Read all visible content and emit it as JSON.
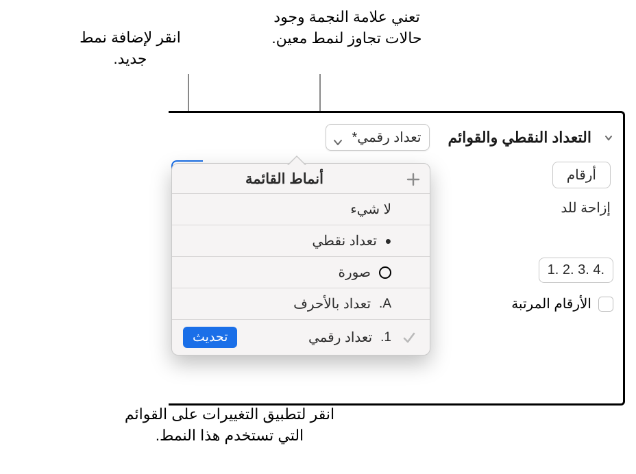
{
  "callouts": {
    "asterisk": "تعني علامة النجمة وجود حالات تجاوز لنمط معين.",
    "add_style": "انقر لإضافة نمط جديد.",
    "update": "انقر لتطبيق التغييرات على القوائم التي تستخدم هذا النمط."
  },
  "panel": {
    "section_title": "التعداد النقطي والقوائم",
    "style_button_label": "تعداد رقمي*",
    "numbers_button": "أرقام",
    "indent_label": "إزاحة للد",
    "number_example": "1. 2. 3. 4.",
    "ordered_numbers_label": "الأرقام المرتبة"
  },
  "popover": {
    "title": "أنماط القائمة",
    "items": [
      {
        "label": "لا شيء"
      },
      {
        "label": "تعداد نقطي"
      },
      {
        "label": "صورة"
      },
      {
        "label": "تعداد بالأحرف",
        "prefix": "A."
      },
      {
        "label": "تعداد رقمي",
        "prefix": "1.",
        "selected": true,
        "update": true
      }
    ],
    "update_label": "تحديث"
  }
}
